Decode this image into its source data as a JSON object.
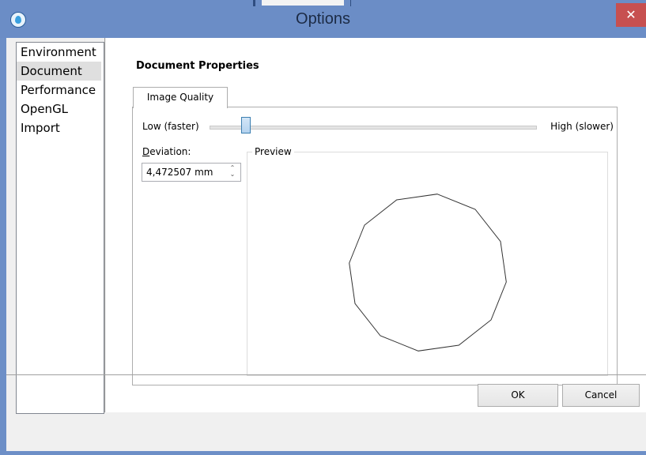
{
  "window": {
    "title": "Options",
    "close_glyph": "✕",
    "icon": "app-droplet-icon"
  },
  "sidebar": {
    "items": [
      {
        "label": "Environment",
        "selected": false
      },
      {
        "label": "Document",
        "selected": true
      },
      {
        "label": "Performance",
        "selected": false
      },
      {
        "label": "OpenGL",
        "selected": false
      },
      {
        "label": "Import",
        "selected": false
      }
    ]
  },
  "main": {
    "section_title": "Document Properties",
    "tabs": [
      {
        "label": "Image Quality",
        "active": true
      }
    ],
    "quality": {
      "low_label": "Low (faster)",
      "high_label": "High (slower)",
      "slider_value_fraction": 0.1
    },
    "deviation": {
      "label_underlined": "D",
      "label_rest": "eviation:",
      "value": "4,472507 mm"
    },
    "preview": {
      "label": "Preview",
      "polygon_sides": 12
    }
  },
  "footer": {
    "ok_label": "OK",
    "cancel_label": "Cancel"
  },
  "colors": {
    "titlebar": "#6b8dc6",
    "close_button": "#c75050",
    "slider_thumb": "#b4d3ef"
  }
}
